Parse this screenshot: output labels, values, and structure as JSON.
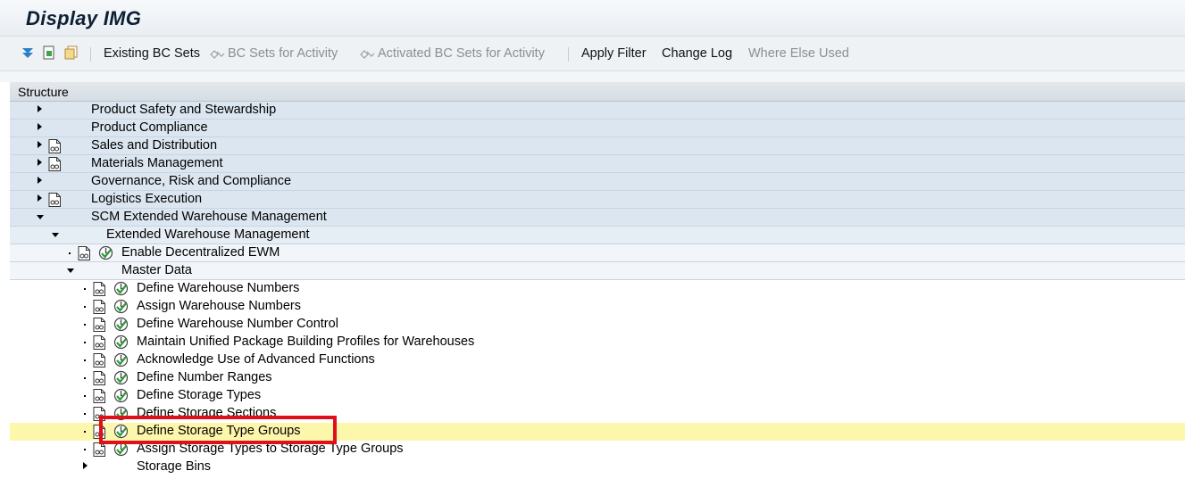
{
  "window": {
    "title": "Display IMG"
  },
  "toolbar": {
    "items": [
      {
        "label": "Existing BC Sets",
        "enabled": true
      },
      {
        "label": "BC Sets for Activity",
        "enabled": false
      },
      {
        "label": "Activated BC Sets for Activity",
        "enabled": false
      },
      {
        "label": "Apply Filter",
        "enabled": true
      },
      {
        "label": "Change Log",
        "enabled": true
      },
      {
        "label": "Where Else Used",
        "enabled": false
      }
    ],
    "icons": [
      "expand-all-icon",
      "find-icon",
      "copy-icon"
    ]
  },
  "structure": {
    "header": "Structure",
    "rows": [
      {
        "label": "Product Safety and Stewardship",
        "level": 0,
        "state": "collapsed",
        "doc": false,
        "activity": false
      },
      {
        "label": "Product Compliance",
        "level": 0,
        "state": "collapsed",
        "doc": false,
        "activity": false
      },
      {
        "label": "Sales and Distribution",
        "level": 0,
        "state": "collapsed",
        "doc": true,
        "activity": false
      },
      {
        "label": "Materials Management",
        "level": 0,
        "state": "collapsed",
        "doc": true,
        "activity": false
      },
      {
        "label": "Governance, Risk and Compliance",
        "level": 0,
        "state": "collapsed",
        "doc": false,
        "activity": false
      },
      {
        "label": "Logistics Execution",
        "level": 0,
        "state": "collapsed",
        "doc": true,
        "activity": false
      },
      {
        "label": "SCM Extended Warehouse Management",
        "level": 0,
        "state": "expanded",
        "doc": false,
        "activity": false
      },
      {
        "label": "Extended Warehouse Management",
        "level": 1,
        "state": "expanded",
        "doc": false,
        "activity": false
      },
      {
        "label": "Enable Decentralized EWM",
        "level": 2,
        "state": "leaf",
        "doc": true,
        "activity": true
      },
      {
        "label": "Master Data",
        "level": 2,
        "state": "expanded",
        "doc": false,
        "activity": false
      },
      {
        "label": "Define Warehouse Numbers",
        "level": 3,
        "state": "leaf",
        "doc": true,
        "activity": true
      },
      {
        "label": "Assign Warehouse Numbers",
        "level": 3,
        "state": "leaf",
        "doc": true,
        "activity": true
      },
      {
        "label": "Define Warehouse Number Control",
        "level": 3,
        "state": "leaf",
        "doc": true,
        "activity": true
      },
      {
        "label": "Maintain Unified Package Building Profiles for Warehouses",
        "level": 3,
        "state": "leaf",
        "doc": true,
        "activity": true
      },
      {
        "label": "Acknowledge Use of Advanced Functions",
        "level": 3,
        "state": "leaf",
        "doc": true,
        "activity": true
      },
      {
        "label": "Define Number Ranges",
        "level": 3,
        "state": "leaf",
        "doc": true,
        "activity": true
      },
      {
        "label": "Define Storage Types",
        "level": 3,
        "state": "leaf",
        "doc": true,
        "activity": true
      },
      {
        "label": "Define Storage Sections",
        "level": 3,
        "state": "leaf",
        "doc": true,
        "activity": true
      },
      {
        "label": "Define Storage Type Groups",
        "level": 3,
        "state": "leaf",
        "doc": true,
        "activity": true,
        "selected": true
      },
      {
        "label": "Assign Storage Types to Storage Type Groups",
        "level": 3,
        "state": "leaf",
        "doc": true,
        "activity": true
      },
      {
        "label": "Storage Bins",
        "level": 3,
        "state": "collapsed",
        "doc": false,
        "activity": false
      }
    ]
  },
  "colors": {
    "highlight_border": "#e0101a",
    "selected_row": "#fdf7ac"
  }
}
